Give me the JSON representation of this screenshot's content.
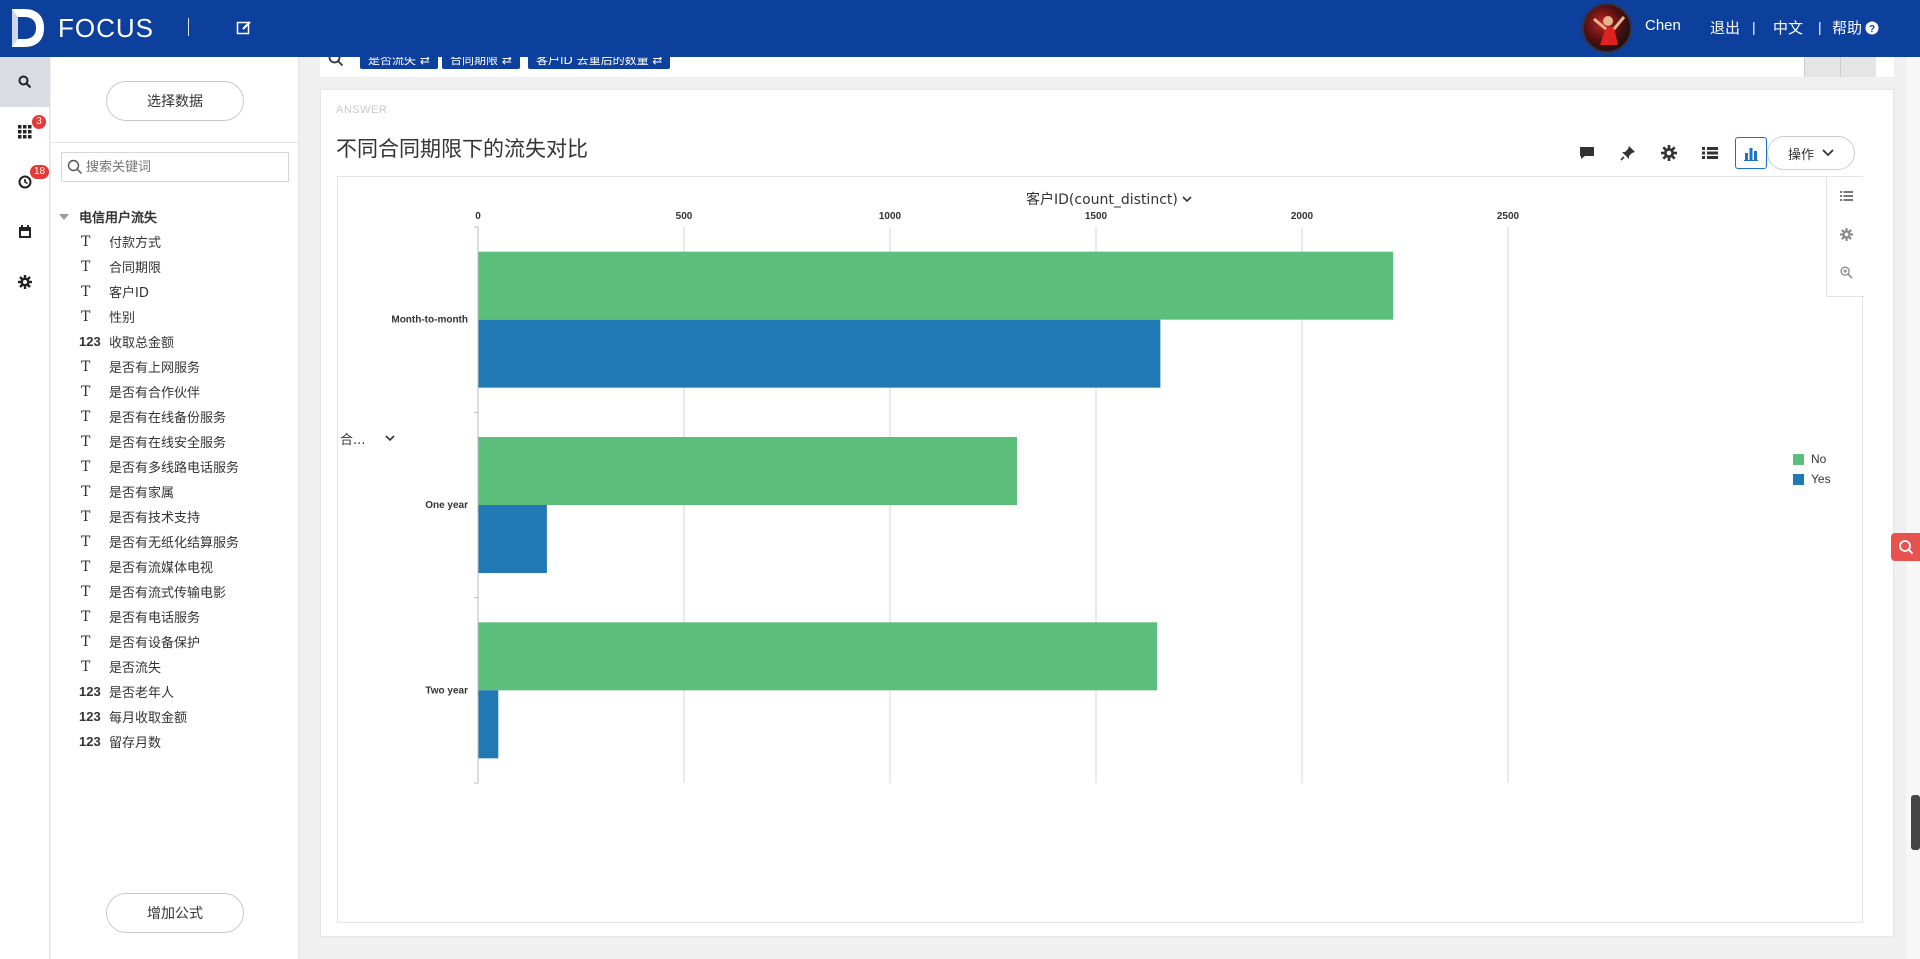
{
  "app": {
    "brand": "FOCUS",
    "user": "Chen",
    "logout": "退出",
    "language": "中文",
    "help": "帮助",
    "brand_color": "#0d3f9c"
  },
  "rail": {
    "items": [
      {
        "name": "search-icon",
        "badge": ""
      },
      {
        "name": "apps-icon",
        "badge": "3"
      },
      {
        "name": "history-icon",
        "badge": "18"
      },
      {
        "name": "calendar-icon",
        "badge": ""
      },
      {
        "name": "gear-icon",
        "badge": ""
      }
    ]
  },
  "datapanel": {
    "select_data": "选择数据",
    "search_placeholder": "搜索关键词",
    "dataset": "电信用户流失",
    "add_formula": "增加公式",
    "fields": [
      {
        "type": "T",
        "label": "付款方式"
      },
      {
        "type": "T",
        "label": "合同期限"
      },
      {
        "type": "T",
        "label": "客户ID"
      },
      {
        "type": "T",
        "label": "性别"
      },
      {
        "type": "123",
        "label": "收取总金额"
      },
      {
        "type": "T",
        "label": "是否有上网服务"
      },
      {
        "type": "T",
        "label": "是否有合作伙伴"
      },
      {
        "type": "T",
        "label": "是否有在线备份服务"
      },
      {
        "type": "T",
        "label": "是否有在线安全服务"
      },
      {
        "type": "T",
        "label": "是否有多线路电话服务"
      },
      {
        "type": "T",
        "label": "是否有家属"
      },
      {
        "type": "T",
        "label": "是否有技术支持"
      },
      {
        "type": "T",
        "label": "是否有无纸化结算服务"
      },
      {
        "type": "T",
        "label": "是否有流媒体电视"
      },
      {
        "type": "T",
        "label": "是否有流式传输电影"
      },
      {
        "type": "T",
        "label": "是否有电话服务"
      },
      {
        "type": "T",
        "label": "是否有设备保护"
      },
      {
        "type": "T",
        "label": "是否流失"
      },
      {
        "type": "123",
        "label": "是否老年人"
      },
      {
        "type": "123",
        "label": "每月收取金额"
      },
      {
        "type": "123",
        "label": "留存月数"
      }
    ]
  },
  "searchbar": {
    "chips": [
      "是否流失",
      "合同期限",
      "客户ID 去重后的数量"
    ]
  },
  "answer": {
    "label": "ANSWER",
    "title": "不同合同期限下的流失对比",
    "ops_label": "操作",
    "measure_selector": "客户ID(count_distinct)",
    "dimension_selector": "合..."
  },
  "chart_data": {
    "type": "bar",
    "orientation": "horizontal",
    "categories": [
      "Month-to-month",
      "One year",
      "Two year"
    ],
    "series": [
      {
        "name": "No",
        "color": "#5bbf7b",
        "values": [
          2220,
          1307,
          1647
        ]
      },
      {
        "name": "Yes",
        "color": "#2078b4",
        "values": [
          1655,
          166,
          48
        ]
      }
    ],
    "xlabel": "客户ID(count_distinct)",
    "xlim": [
      0,
      2500
    ],
    "xticks": [
      0,
      500,
      1000,
      1500,
      2000,
      2500
    ],
    "grid": true,
    "legend": "right"
  }
}
